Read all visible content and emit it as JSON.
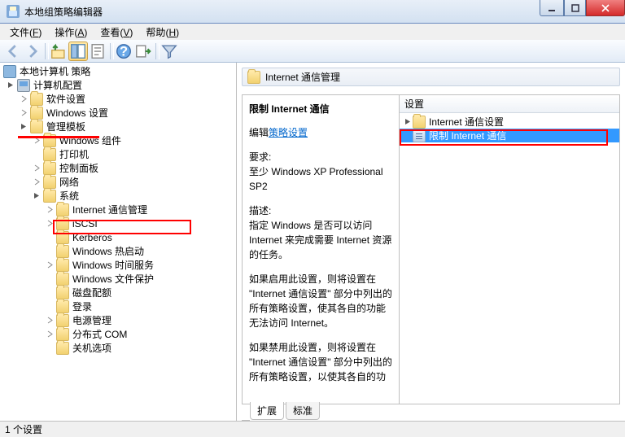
{
  "window": {
    "title": "本地组策略编辑器"
  },
  "menu": {
    "file": {
      "label": "文件",
      "accel": "F"
    },
    "action": {
      "label": "操作",
      "accel": "A"
    },
    "view": {
      "label": "查看",
      "accel": "V"
    },
    "help": {
      "label": "帮助",
      "accel": "H"
    }
  },
  "tree": {
    "root": "本地计算机 策略",
    "computer_config": "计算机配置",
    "software_settings": "软件设置",
    "windows_settings": "Windows 设置",
    "admin_templates": "管理模板",
    "windows_components": "Windows 组件",
    "printers": "打印机",
    "control_panel": "控制面板",
    "network": "网络",
    "system": "系统",
    "internet_comm_mgmt": "Internet 通信管理",
    "iscsi": "iSCSI",
    "kerberos": "Kerberos",
    "windows_hot_start": "Windows 热启动",
    "windows_time_service": "Windows 时间服务",
    "windows_file_protection": "Windows 文件保护",
    "disk_quota": "磁盘配额",
    "logon": "登录",
    "power_mgmt": "电源管理",
    "distributed_com": "分布式 COM",
    "shutdown_options": "关机选项"
  },
  "content": {
    "header": "Internet 通信管理",
    "desc_title": "限制 Internet 通信",
    "edit_label": "编辑",
    "edit_link": "策略设置",
    "req_label": "要求:",
    "req_text": "至少 Windows XP Professional SP2",
    "descr_label": "描述:",
    "descr_text": "指定 Windows 是否可以访问 Internet 来完成需要 Internet 资源的任务。",
    "enable_text": "如果启用此设置，则将设置在 \"Internet 通信设置\" 部分中列出的所有策略设置，使其各自的功能无法访问 Internet。",
    "disable_text": "如果禁用此设置，则将设置在 \"Internet 通信设置\" 部分中列出的所有策略设置，以使其各自的功"
  },
  "list": {
    "header": "设置",
    "item_settings": "Internet 通信设置",
    "item_restrict": "限制 Internet 通信"
  },
  "tabs": {
    "extended": "扩展",
    "standard": "标准"
  },
  "status": "1 个设置"
}
